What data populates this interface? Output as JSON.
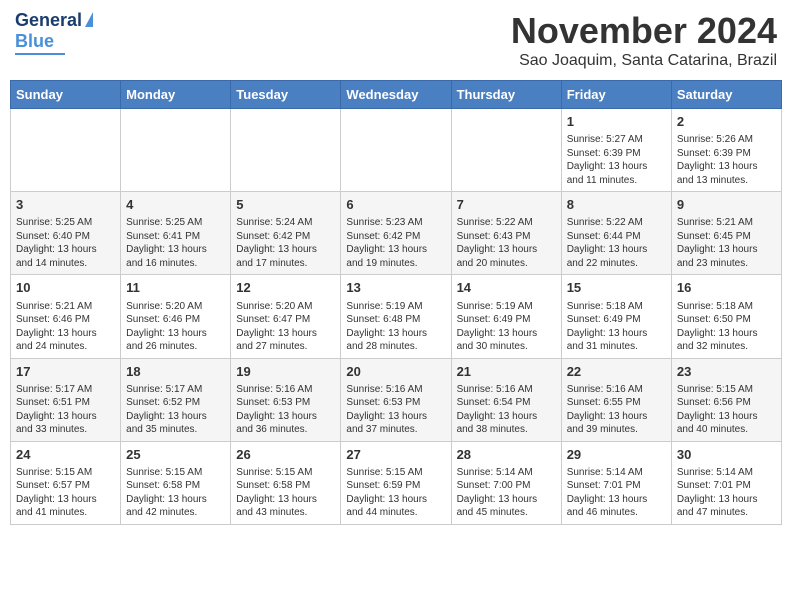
{
  "header": {
    "logo_general": "General",
    "logo_blue": "Blue",
    "month_title": "November 2024",
    "location": "Sao Joaquim, Santa Catarina, Brazil"
  },
  "calendar": {
    "days_of_week": [
      "Sunday",
      "Monday",
      "Tuesday",
      "Wednesday",
      "Thursday",
      "Friday",
      "Saturday"
    ],
    "weeks": [
      [
        {
          "day": "",
          "info": ""
        },
        {
          "day": "",
          "info": ""
        },
        {
          "day": "",
          "info": ""
        },
        {
          "day": "",
          "info": ""
        },
        {
          "day": "",
          "info": ""
        },
        {
          "day": "1",
          "info": "Sunrise: 5:27 AM\nSunset: 6:39 PM\nDaylight: 13 hours\nand 11 minutes."
        },
        {
          "day": "2",
          "info": "Sunrise: 5:26 AM\nSunset: 6:39 PM\nDaylight: 13 hours\nand 13 minutes."
        }
      ],
      [
        {
          "day": "3",
          "info": "Sunrise: 5:25 AM\nSunset: 6:40 PM\nDaylight: 13 hours\nand 14 minutes."
        },
        {
          "day": "4",
          "info": "Sunrise: 5:25 AM\nSunset: 6:41 PM\nDaylight: 13 hours\nand 16 minutes."
        },
        {
          "day": "5",
          "info": "Sunrise: 5:24 AM\nSunset: 6:42 PM\nDaylight: 13 hours\nand 17 minutes."
        },
        {
          "day": "6",
          "info": "Sunrise: 5:23 AM\nSunset: 6:42 PM\nDaylight: 13 hours\nand 19 minutes."
        },
        {
          "day": "7",
          "info": "Sunrise: 5:22 AM\nSunset: 6:43 PM\nDaylight: 13 hours\nand 20 minutes."
        },
        {
          "day": "8",
          "info": "Sunrise: 5:22 AM\nSunset: 6:44 PM\nDaylight: 13 hours\nand 22 minutes."
        },
        {
          "day": "9",
          "info": "Sunrise: 5:21 AM\nSunset: 6:45 PM\nDaylight: 13 hours\nand 23 minutes."
        }
      ],
      [
        {
          "day": "10",
          "info": "Sunrise: 5:21 AM\nSunset: 6:46 PM\nDaylight: 13 hours\nand 24 minutes."
        },
        {
          "day": "11",
          "info": "Sunrise: 5:20 AM\nSunset: 6:46 PM\nDaylight: 13 hours\nand 26 minutes."
        },
        {
          "day": "12",
          "info": "Sunrise: 5:20 AM\nSunset: 6:47 PM\nDaylight: 13 hours\nand 27 minutes."
        },
        {
          "day": "13",
          "info": "Sunrise: 5:19 AM\nSunset: 6:48 PM\nDaylight: 13 hours\nand 28 minutes."
        },
        {
          "day": "14",
          "info": "Sunrise: 5:19 AM\nSunset: 6:49 PM\nDaylight: 13 hours\nand 30 minutes."
        },
        {
          "day": "15",
          "info": "Sunrise: 5:18 AM\nSunset: 6:49 PM\nDaylight: 13 hours\nand 31 minutes."
        },
        {
          "day": "16",
          "info": "Sunrise: 5:18 AM\nSunset: 6:50 PM\nDaylight: 13 hours\nand 32 minutes."
        }
      ],
      [
        {
          "day": "17",
          "info": "Sunrise: 5:17 AM\nSunset: 6:51 PM\nDaylight: 13 hours\nand 33 minutes."
        },
        {
          "day": "18",
          "info": "Sunrise: 5:17 AM\nSunset: 6:52 PM\nDaylight: 13 hours\nand 35 minutes."
        },
        {
          "day": "19",
          "info": "Sunrise: 5:16 AM\nSunset: 6:53 PM\nDaylight: 13 hours\nand 36 minutes."
        },
        {
          "day": "20",
          "info": "Sunrise: 5:16 AM\nSunset: 6:53 PM\nDaylight: 13 hours\nand 37 minutes."
        },
        {
          "day": "21",
          "info": "Sunrise: 5:16 AM\nSunset: 6:54 PM\nDaylight: 13 hours\nand 38 minutes."
        },
        {
          "day": "22",
          "info": "Sunrise: 5:16 AM\nSunset: 6:55 PM\nDaylight: 13 hours\nand 39 minutes."
        },
        {
          "day": "23",
          "info": "Sunrise: 5:15 AM\nSunset: 6:56 PM\nDaylight: 13 hours\nand 40 minutes."
        }
      ],
      [
        {
          "day": "24",
          "info": "Sunrise: 5:15 AM\nSunset: 6:57 PM\nDaylight: 13 hours\nand 41 minutes."
        },
        {
          "day": "25",
          "info": "Sunrise: 5:15 AM\nSunset: 6:58 PM\nDaylight: 13 hours\nand 42 minutes."
        },
        {
          "day": "26",
          "info": "Sunrise: 5:15 AM\nSunset: 6:58 PM\nDaylight: 13 hours\nand 43 minutes."
        },
        {
          "day": "27",
          "info": "Sunrise: 5:15 AM\nSunset: 6:59 PM\nDaylight: 13 hours\nand 44 minutes."
        },
        {
          "day": "28",
          "info": "Sunrise: 5:14 AM\nSunset: 7:00 PM\nDaylight: 13 hours\nand 45 minutes."
        },
        {
          "day": "29",
          "info": "Sunrise: 5:14 AM\nSunset: 7:01 PM\nDaylight: 13 hours\nand 46 minutes."
        },
        {
          "day": "30",
          "info": "Sunrise: 5:14 AM\nSunset: 7:01 PM\nDaylight: 13 hours\nand 47 minutes."
        }
      ]
    ]
  }
}
